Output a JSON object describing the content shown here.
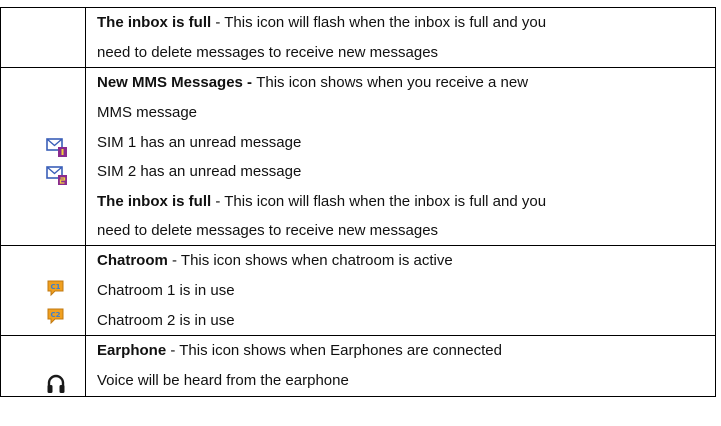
{
  "rows": [
    {
      "lines": [
        {
          "bold": "The inbox is full",
          "rest": " - This icon will flash when the inbox is full and you"
        },
        {
          "bold": "",
          "rest": "need to delete messages to receive new messages"
        }
      ],
      "icons": []
    },
    {
      "lines": [
        {
          "bold": "New MMS Messages - ",
          "rest": "This icon shows when you receive a new"
        },
        {
          "bold": "",
          "rest": "MMS message"
        },
        {
          "bold": "",
          "rest": "SIM 1 has an unread message"
        },
        {
          "bold": "",
          "rest": "SIM 2 has an unread message"
        },
        {
          "bold": "The inbox is full",
          "rest": " - This icon will flash when the inbox is full and you"
        },
        {
          "bold": "",
          "rest": "need to delete messages to receive new messages"
        }
      ],
      "icons": [
        "mms-sim1-icon",
        "mms-sim2-icon"
      ]
    },
    {
      "lines": [
        {
          "bold": "Chatroom",
          "rest": " - This icon shows when chatroom is active"
        },
        {
          "bold": "",
          "rest": "Chatroom 1 is in use"
        },
        {
          "bold": "",
          "rest": "Chatroom 2 is in use"
        }
      ],
      "icons": [
        "chatroom-1-icon",
        "chatroom-2-icon"
      ]
    },
    {
      "lines": [
        {
          "bold": "Earphone",
          "rest": " - This icon shows when Earphones are connected"
        },
        {
          "bold": "",
          "rest": "Voice will be heard from the earphone"
        }
      ],
      "icons": [
        "earphone-icon"
      ]
    }
  ],
  "colors": {
    "mail_blue": "#3a5fb8",
    "sim_badge": "#8a2b8f",
    "chat_orange": "#f0a020",
    "chat_blue": "#3a7fd0",
    "earphone": "#1a1a1a"
  }
}
